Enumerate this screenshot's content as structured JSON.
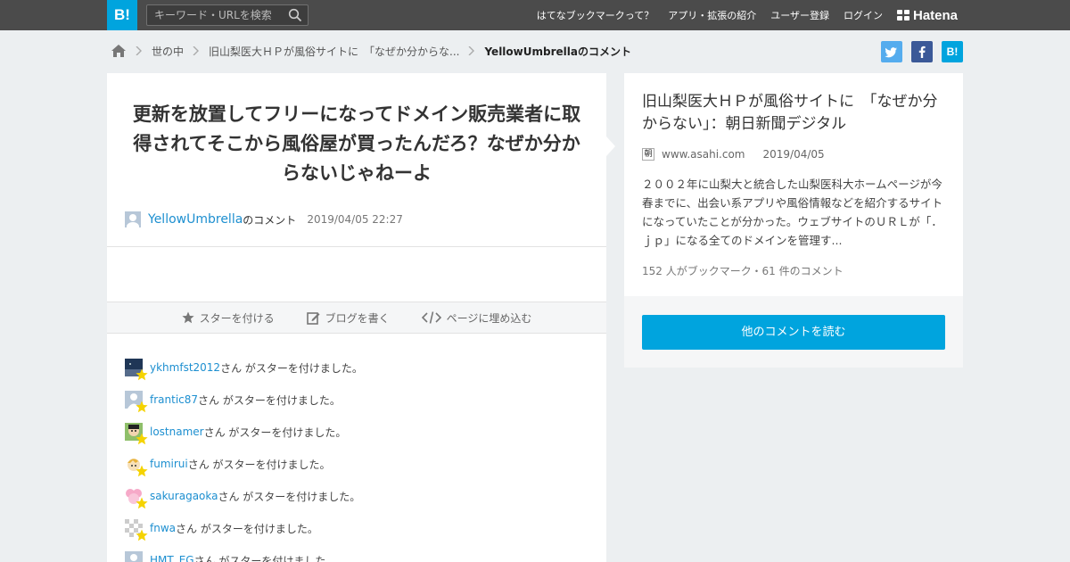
{
  "header": {
    "logo": "B!",
    "search_placeholder": "キーワード・URLを検索",
    "nav": [
      "はてなブックマークって？",
      "アプリ・拡張の紹介",
      "ユーザー登録",
      "ログイン"
    ],
    "brand": "Hatena"
  },
  "breadcrumb": {
    "items": [
      "世の中",
      "旧山梨医大ＨＰが風俗サイトに　「なぜか分からな..."
    ],
    "current": "YellowUmbrellaのコメント"
  },
  "share": {
    "hatena_label": "B!"
  },
  "comment": {
    "text": "更新を放置してフリーになってドメイン販売業者に取得されてそこから風俗屋が買ったんだろ？なぜか分からないじゃねーよ",
    "user": "YellowUmbrella",
    "suffix": "のコメント",
    "date": "2019/04/05 22:27"
  },
  "toolbar": {
    "star": "スターを付ける",
    "blog": "ブログを書く",
    "embed": "ページに埋め込む"
  },
  "stars": {
    "suffix": "さん がスターを付けました。",
    "users": [
      "ykhmfst2012",
      "frantic87",
      "lostnamer",
      "fumirui",
      "sakuragaoka",
      "fnwa",
      "HMT_EG"
    ]
  },
  "entry": {
    "title": "旧山梨医大ＨＰが風俗サイトに　「なぜか分からない」：朝日新聞デジタル",
    "favicon": "朝",
    "site": "www.asahi.com",
    "date": "2019/04/05",
    "excerpt": "２００２年に山梨大と統合した山梨医科大ホームページが今春までに、出会い系アプリや風俗情報などを紹介するサイトになっていたことが分かった。ウェブサイトのＵＲＬが「．ｊｐ」になる全てのドメインを管理す...",
    "counts": "152 人がブックマーク・61 件のコメント",
    "more_button": "他のコメントを読む"
  }
}
